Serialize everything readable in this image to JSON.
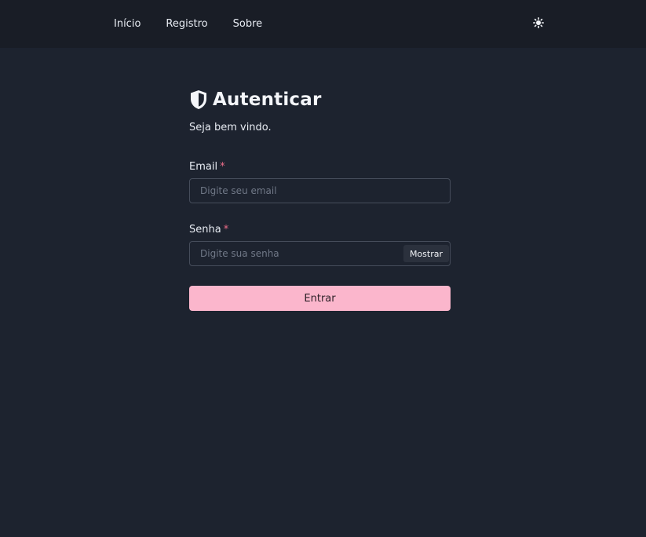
{
  "nav": {
    "items": [
      {
        "label": "Início"
      },
      {
        "label": "Registro"
      },
      {
        "label": "Sobre"
      }
    ],
    "theme_toggle_icon": "sun-icon"
  },
  "auth": {
    "icon": "shield-icon",
    "title": "Autenticar",
    "subtitle": "Seja bem vindo.",
    "email": {
      "label": "Email",
      "required_mark": "*",
      "value": "",
      "placeholder": "Digite seu email"
    },
    "password": {
      "label": "Senha",
      "required_mark": "*",
      "value": "",
      "placeholder": "Digite sua senha",
      "toggle_label": "Mostrar"
    },
    "submit_label": "Entrar"
  },
  "colors": {
    "background": "#1d232f",
    "topbar": "#191d26",
    "accent": "#fbb6cc",
    "required": "#ef6e8a"
  }
}
